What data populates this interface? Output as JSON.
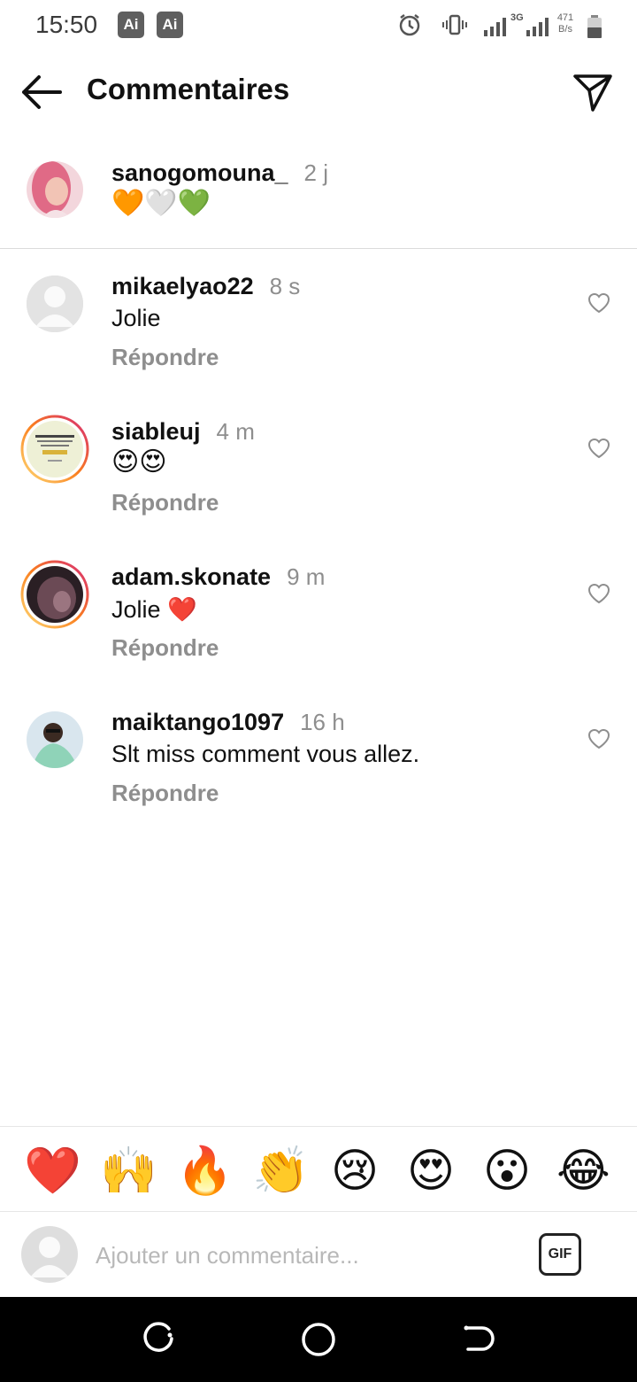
{
  "status_bar": {
    "time": "15:50",
    "badges": [
      "Ai",
      "Ai"
    ],
    "network": "3G",
    "speed_value": "471",
    "speed_unit": "B/s",
    "icons": [
      "alarm-icon",
      "vibrate-icon",
      "signal-icon",
      "signal-icon",
      "battery-icon"
    ]
  },
  "header": {
    "title": "Commentaires",
    "back_icon": "arrow-left-icon",
    "send_icon": "paper-plane-icon"
  },
  "caption": {
    "username": "sanogomouna_",
    "time": "2 j",
    "text": "🧡🤍💚"
  },
  "comments": [
    {
      "username": "mikaelyao22",
      "time": "8 s",
      "text": "Jolie",
      "reply": "Répondre",
      "story_ring": false
    },
    {
      "username": "siableuj",
      "time": "4 m",
      "text": "😍😍",
      "reply": "Répondre",
      "story_ring": true
    },
    {
      "username": "adam.skonate",
      "time": "9 m",
      "text": "Jolie ❤️",
      "reply": "Répondre",
      "story_ring": true
    },
    {
      "username": "maiktango1097",
      "time": "16 h",
      "text": "Slt miss comment vous allez.",
      "reply": "Répondre",
      "story_ring": false
    }
  ],
  "quick_reactions": [
    "❤️",
    "🙌",
    "🔥",
    "👏",
    "😢",
    "😍",
    "😮",
    "😂"
  ],
  "composer": {
    "placeholder": "Ajouter un commentaire...",
    "gif_label": "GIF"
  },
  "nav_bar": {
    "icons": [
      "recent-apps-icon",
      "home-icon",
      "back-nav-icon"
    ]
  },
  "colors": {
    "text_primary": "#111111",
    "text_secondary": "#8e8e8e",
    "divider": "#dbdbdb",
    "story_ring_start": "#feda75",
    "story_ring_end": "#d62976"
  }
}
